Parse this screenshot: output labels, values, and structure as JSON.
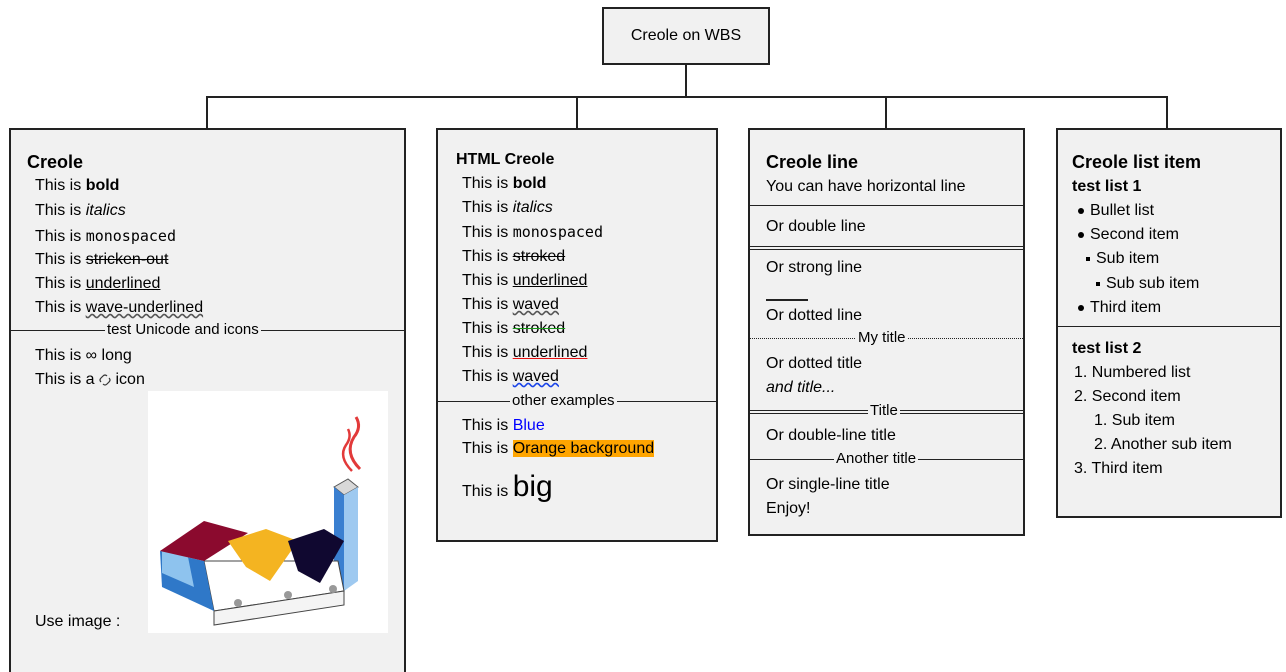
{
  "root": {
    "label": "Creole on WBS"
  },
  "box1": {
    "title": "Creole",
    "prefix": "This is",
    "bold": "bold",
    "italics": "italics",
    "mono": "monospaced",
    "strike": "stricken-out",
    "underlined": "underlined",
    "wave": "wave-underlined",
    "sep_title": "test Unicode and icons",
    "infinity_line": "This is ∞ long",
    "icon_line_a": "This is a",
    "icon_line_b": "icon",
    "image_label": "Use image :"
  },
  "box2": {
    "title": "HTML Creole",
    "prefix": "This is",
    "bold": "bold",
    "italics": "italics",
    "mono": "monospaced",
    "stroked": "stroked",
    "underlined": "underlined",
    "waved": "waved",
    "stroked2": "stroked",
    "underlined2": "underlined",
    "waved2": "waved",
    "sep_title": "other examples",
    "blue": "Blue",
    "orange": "Orange background",
    "big": "big",
    "colors": {
      "blue": "#0000ff",
      "orange": "#ffa500"
    }
  },
  "box3": {
    "title": "Creole line",
    "l1": "You can have horizontal line",
    "l2": "Or double line",
    "l3": "Or strong line",
    "l4": "Or dotted line",
    "sep_my_title": "My title",
    "l5": "Or dotted title",
    "l6": "and title...",
    "sep_title": "Title",
    "l7": "Or double-line title",
    "sep_another": "Another title",
    "l8": "Or single-line title",
    "l9": "Enjoy!"
  },
  "box4": {
    "title": "Creole list item",
    "list1_title": "test list 1",
    "b1": "Bullet list",
    "b2": "Second item",
    "b3": "Sub item",
    "b4": "Sub sub item",
    "b5": "Third item",
    "list2_title": "test list 2",
    "n1": "1. Numbered list",
    "n2": "2. Second item",
    "n3": "1. Sub item",
    "n4": "2. Another sub item",
    "n5": "3. Third item"
  }
}
